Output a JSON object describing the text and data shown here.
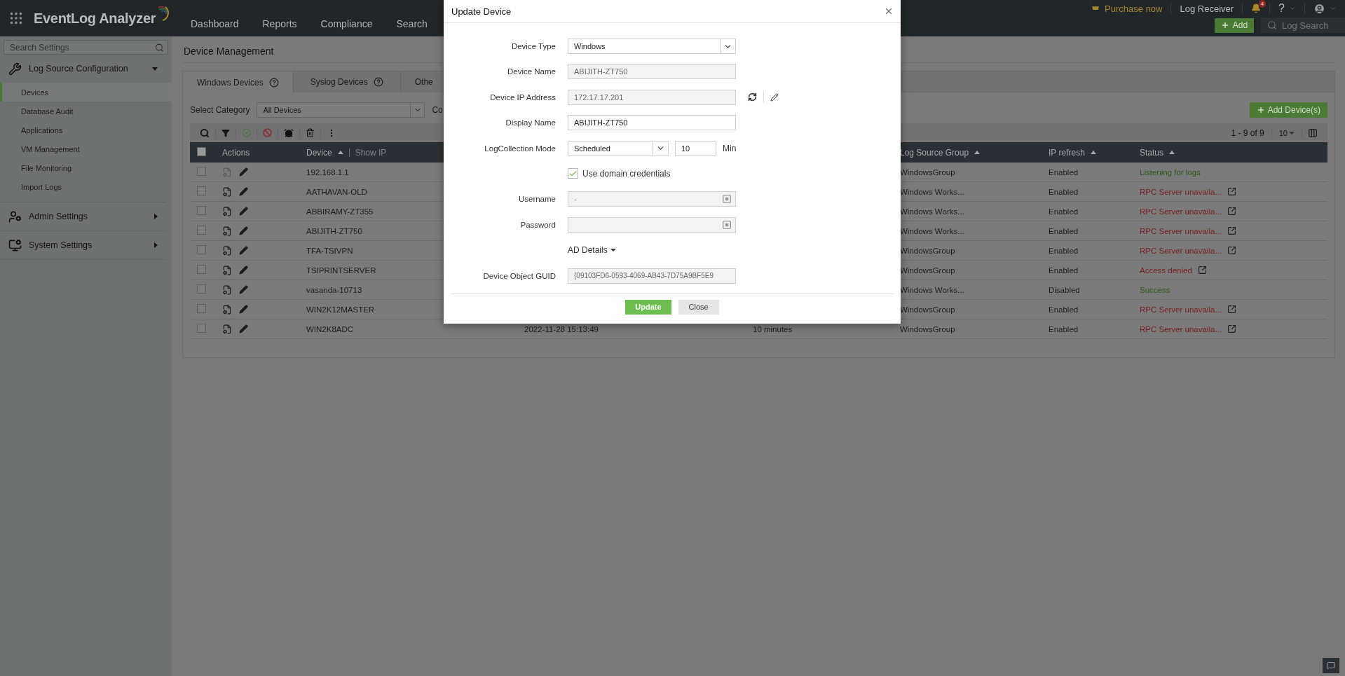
{
  "header": {
    "app_name": "EventLog Analyzer",
    "nav": [
      {
        "label": "Dashboard",
        "selected": false
      },
      {
        "label": "Reports",
        "selected": false
      },
      {
        "label": "Compliance",
        "selected": false
      },
      {
        "label": "Search",
        "selected": false
      }
    ],
    "purchase": "Purchase now",
    "log_receiver": "Log Receiver",
    "notification_count": "4",
    "help": "?",
    "add_button": "Add",
    "log_search": {
      "placeholder": "Log Search"
    }
  },
  "sidebar": {
    "search": {
      "placeholder": "Search Settings"
    },
    "sections": [
      {
        "label": "Log Source Configuration",
        "expanded": true,
        "children": [
          {
            "label": "Devices",
            "selected": true
          },
          {
            "label": "Database Audit",
            "selected": false
          },
          {
            "label": "Applications",
            "selected": false
          },
          {
            "label": "VM Management",
            "selected": false
          },
          {
            "label": "File Monitoring",
            "selected": false
          },
          {
            "label": "Import Logs",
            "selected": false
          }
        ]
      },
      {
        "label": "Admin Settings",
        "expanded": false
      },
      {
        "label": "System Settings",
        "expanded": false
      }
    ]
  },
  "page_title": "Device Management",
  "tabs": [
    {
      "label": "Windows Devices",
      "selected": true,
      "help": true
    },
    {
      "label": "Syslog Devices",
      "selected": false,
      "help": true
    },
    {
      "label": "Othe",
      "selected": false,
      "help": false
    }
  ],
  "filter": {
    "label": "Select Category",
    "value": "All Devices",
    "next_label": "Co"
  },
  "add_devices_button": "Add Device(s)",
  "pagination": {
    "range": "1 - 9 of 9",
    "page_size": "10"
  },
  "table": {
    "select_all_checked": false,
    "columns": [
      {
        "label": "Actions",
        "sortable": false
      },
      {
        "label": "Device",
        "sortable": true,
        "link": "Show IP"
      },
      {
        "label": "Log Source Group",
        "sortable": true
      },
      {
        "label": "IP refresh",
        "sortable": true
      },
      {
        "label": "Status",
        "sortable": true
      }
    ],
    "rows": [
      {
        "checked": false,
        "config_enabled": false,
        "device": "192.168.1.1",
        "log_source_group": "WindowsGroup",
        "ip_refresh": "Enabled",
        "status": "Listening for logs",
        "color": "#2c5a18",
        "details_link": false
      },
      {
        "checked": false,
        "config_enabled": true,
        "device": "AATHAVAN-OLD",
        "log_source_group": "Windows Works...",
        "ip_refresh": "Enabled",
        "status": "RPC Server unavaila...",
        "color": "#7a1c1c",
        "details_link": true
      },
      {
        "checked": false,
        "config_enabled": true,
        "device": "ABBIRAMY-ZT355",
        "log_source_group": "Windows Works...",
        "ip_refresh": "Enabled",
        "status": "RPC Server unavaila...",
        "color": "#7a1c1c",
        "details_link": true
      },
      {
        "checked": false,
        "config_enabled": true,
        "device": "ABIJITH-ZT750",
        "log_source_group": "Windows Works...",
        "ip_refresh": "Enabled",
        "status": "RPC Server unavaila...",
        "color": "#7a1c1c",
        "details_link": true
      },
      {
        "checked": false,
        "config_enabled": true,
        "device": "TFA-TSIVPN",
        "log_source_group": "WindowsGroup",
        "ip_refresh": "Enabled",
        "status": "RPC Server unavaila...",
        "color": "#7a1c1c",
        "details_link": true
      },
      {
        "checked": false,
        "config_enabled": true,
        "device": "TSIPRINTSERVER",
        "log_source_group": "WindowsGroup",
        "ip_refresh": "Enabled",
        "status": "Access denied",
        "color": "#7a1c1c",
        "details_link": true
      },
      {
        "checked": false,
        "config_enabled": true,
        "device": "vasanda-10713",
        "log_source_group": "Windows Works...",
        "ip_refresh": "Disabled",
        "status": "Success",
        "color": "#2c5a18",
        "details_link": false
      },
      {
        "checked": false,
        "config_enabled": true,
        "device": "WIN2K12MASTER",
        "log_source_group": "WindowsGroup",
        "ip_refresh": "Enabled",
        "status": "RPC Server unavaila...",
        "color": "#7a1c1c",
        "details_link": true
      },
      {
        "checked": false,
        "config_enabled": true,
        "device": "WIN2K8ADC",
        "column_4": "2022-11-28 15:13:49",
        "column_5": "10 minutes",
        "log_source_group": "WindowsGroup",
        "ip_refresh": "Enabled",
        "status": "RPC Server unavaila...",
        "color": "#7a1c1c",
        "details_link": true
      }
    ]
  },
  "dialog": {
    "title": "Update Device",
    "fields": [
      {
        "kind": "select",
        "label": "Device Type",
        "value": "Windows"
      },
      {
        "kind": "readonly",
        "label": "Device Name",
        "value": "ABIJITH-ZT750"
      },
      {
        "kind": "ip",
        "label": "Device IP Address",
        "value": "172.17.17.201"
      },
      {
        "kind": "text",
        "label": "Display Name",
        "value": "ABIJITH-ZT750"
      },
      {
        "kind": "interval",
        "label": "LogCollection Mode",
        "value": "Scheduled",
        "number": "10",
        "unit": "Min"
      },
      {
        "kind": "checkbox",
        "text": "Use domain credentials",
        "checked": true
      },
      {
        "kind": "credential",
        "label": "Username",
        "value": "-"
      },
      {
        "kind": "credential",
        "label": "Password"
      },
      {
        "kind": "expander",
        "text": "AD Details",
        "expanded": false
      },
      {
        "kind": "readonly",
        "label": "Device Object GUID",
        "value": "{09103FD6-0593-4069-AB43-7D75A9BF5E9"
      }
    ],
    "buttons": [
      {
        "label": "Update",
        "primary": true
      },
      {
        "label": "Close",
        "primary": false
      }
    ]
  }
}
